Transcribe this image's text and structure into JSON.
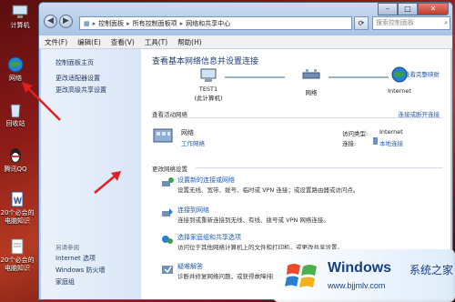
{
  "desktop": {
    "icons": [
      {
        "label": "计算机"
      },
      {
        "label": "网络"
      },
      {
        "label": "回收站"
      },
      {
        "label": "腾讯QQ"
      },
      {
        "label": "20个必会的电脑知识"
      },
      {
        "label": "20个必会的电脑知识"
      }
    ]
  },
  "window": {
    "breadcrumb": [
      "控制面板",
      "所有控制面板项",
      "网络和共享中心"
    ],
    "search_placeholder": "搜索控制面板",
    "menu": [
      "文件(F)",
      "编辑(E)",
      "查看(V)",
      "工具(T)",
      "帮助(H)"
    ]
  },
  "sidebar": {
    "links": [
      "控制面板主页",
      "更改适配器设置",
      "更改高级共享设置"
    ],
    "see_also_header": "另请参阅",
    "see_also": [
      "Internet 选项",
      "Windows 防火墙",
      "家庭组"
    ]
  },
  "main": {
    "heading": "查看基本网络信息并设置连接",
    "full_map_link": "查看完整映射",
    "map": {
      "computer_name": "TEST1",
      "computer_sub": "(此计算机)",
      "network": "网络",
      "internet": "Internet"
    },
    "active_title": "查看活动网络",
    "connect_link": "连接或断开连接",
    "active": {
      "name": "网络",
      "type": "工作网络",
      "access_type_label": "访问类型:",
      "access_type_value": "Internet",
      "connections_label": "连接:",
      "connections_value": "本地连接"
    },
    "change_title": "更改网络设置",
    "tasks": [
      {
        "title": "设置新的连接或网络",
        "desc": "设置无线、宽带、拨号、临时或 VPN 连接；或设置路由器或访问点。"
      },
      {
        "title": "连接到网络",
        "desc": "连接到或重新连接到无线、有线、拨号或 VPN 网络连接。"
      },
      {
        "title": "选择家庭组和共享选项",
        "desc": "访问位于其他网络计算机上的文件和打印机，或更改共享设置。"
      },
      {
        "title": "疑难解答",
        "desc": "诊断并修复网络问题，或获得故障排除信息。"
      }
    ]
  },
  "watermark": {
    "title": "Windows",
    "cn": "系统之家",
    "url": "www.bjjmlv.com"
  },
  "colors": {
    "accent": "#1d5bb4",
    "arrow": "#e02020"
  }
}
